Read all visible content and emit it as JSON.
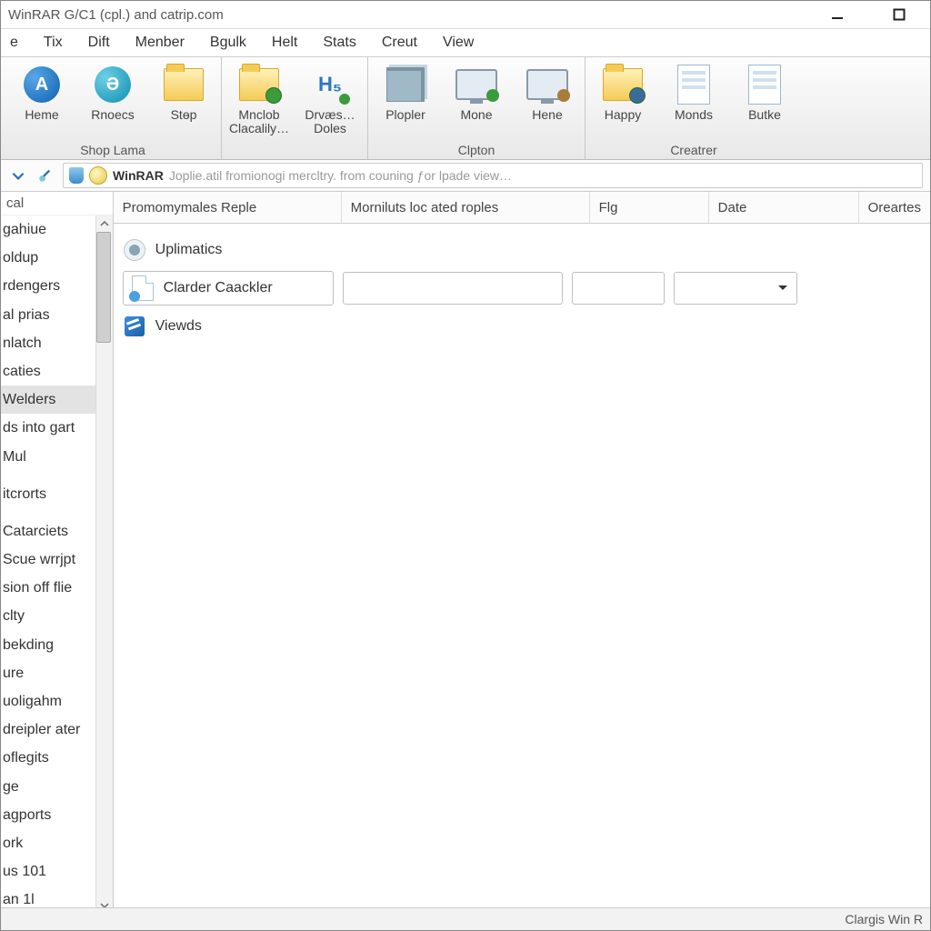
{
  "title": "WinRAR G/C1 (cpl.) and catrip.com",
  "menu": [
    "e",
    "Tix",
    "Dift",
    "Menber",
    "Bgulk",
    "Helt",
    "Stats",
    "Creut",
    "View"
  ],
  "ribbon": {
    "groups": [
      {
        "label": "Shop Lama",
        "buttons": [
          {
            "name": "home-button",
            "label": "Heme",
            "icon": "circ-blue",
            "glyph": "A"
          },
          {
            "name": "rnoecs-button",
            "label": "Rnoecs",
            "icon": "circ-cyan",
            "glyph": "Ә"
          },
          {
            "name": "stop-button",
            "label": "Stɵp",
            "icon": "folder",
            "glyph": ""
          }
        ]
      },
      {
        "label": "",
        "buttons": [
          {
            "name": "mnclob-button",
            "label": "Mnclob Clacalily…",
            "icon": "folder-badge",
            "glyph": ""
          },
          {
            "name": "drvass-button",
            "label": "Drvæs… Doles",
            "icon": "h5",
            "glyph": "H₅"
          }
        ]
      },
      {
        "label": "Clpton",
        "buttons": [
          {
            "name": "plopler-button",
            "label": "Plopler",
            "icon": "stack",
            "glyph": ""
          },
          {
            "name": "mone-button",
            "label": "Mone",
            "icon": "monitor-green",
            "glyph": ""
          },
          {
            "name": "hene-button",
            "label": "Hene",
            "icon": "monitor-brown",
            "glyph": ""
          }
        ]
      },
      {
        "label": "Creatrer",
        "buttons": [
          {
            "name": "happy-button",
            "label": "Happy",
            "icon": "folder-globe",
            "glyph": ""
          },
          {
            "name": "monds-button",
            "label": "Monds",
            "icon": "doc-globe",
            "glyph": ""
          },
          {
            "name": "butke-button",
            "label": "Butke",
            "icon": "doc-plus",
            "glyph": ""
          }
        ]
      }
    ]
  },
  "addressbar": {
    "prefix": "WinRAR",
    "path": "Joplie.atil fromionogi mercltry. from couning ƒor lpade view…"
  },
  "sidebar": {
    "header": "cal",
    "items": [
      "gahiue",
      "oldup",
      "rdengers",
      "al prias",
      "nlatch",
      "caties",
      "Welders",
      "ds into gart",
      "Mul",
      "itcrorts",
      "Catarciets",
      "Scue wrrjpt",
      "sion off flie",
      "clty",
      "bekding",
      "ure",
      "uoligahm",
      "dreipler ater",
      "oflegits",
      "ge",
      "agports",
      "ork",
      "us 101",
      "an 1l"
    ],
    "selected_index": 6
  },
  "columns": [
    "Promomymales Reple",
    "Morniluts loc ated roples",
    "Flg",
    "Date",
    "Oreartes"
  ],
  "rows": [
    {
      "type": "static",
      "icon": "cog",
      "label": "Uplimatics"
    },
    {
      "type": "editable",
      "icon": "doc",
      "label": "Clarder Caackler"
    },
    {
      "type": "static",
      "icon": "sq",
      "label": "Viewds"
    }
  ],
  "status": "Clargis Win R"
}
